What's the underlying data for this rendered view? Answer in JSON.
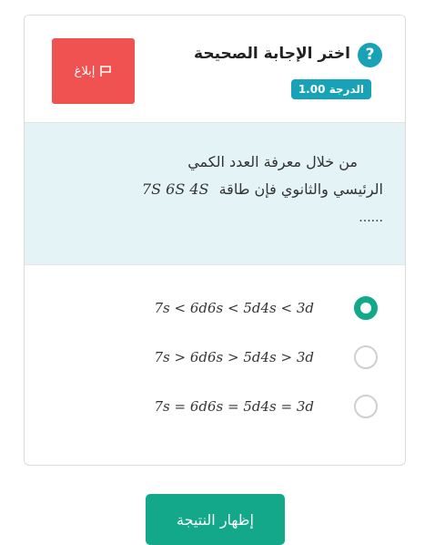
{
  "question_header": {
    "help_icon": "question-circle-icon",
    "title": "اختر الإجابة الصحيحة",
    "grade_label": "الدرجة 1.00",
    "report_button": {
      "label": "إبلاغ",
      "icon": "flag-icon",
      "color": "#f05252"
    }
  },
  "question": {
    "line1": "من خلال معرفة العدد الكمي",
    "line2_text": "الرئيسي والثانوي فإن طاقة",
    "line2_math": "7S   6S   4S",
    "line3": "......"
  },
  "answers": [
    {
      "text": "7s < 6d6s < 5d4s < 3d",
      "selected": true
    },
    {
      "text": "7s > 6d6s > 5d4s > 3d",
      "selected": false
    },
    {
      "text": "7s = 6d6s = 5d4s = 3d",
      "selected": false
    }
  ],
  "show_result_button": {
    "label": "إظهار النتيجة",
    "color": "#12a889"
  },
  "colors": {
    "accent": "#17a2b8",
    "question_bg": "#e3f3f6",
    "success": "#12a889",
    "danger": "#f05252"
  }
}
